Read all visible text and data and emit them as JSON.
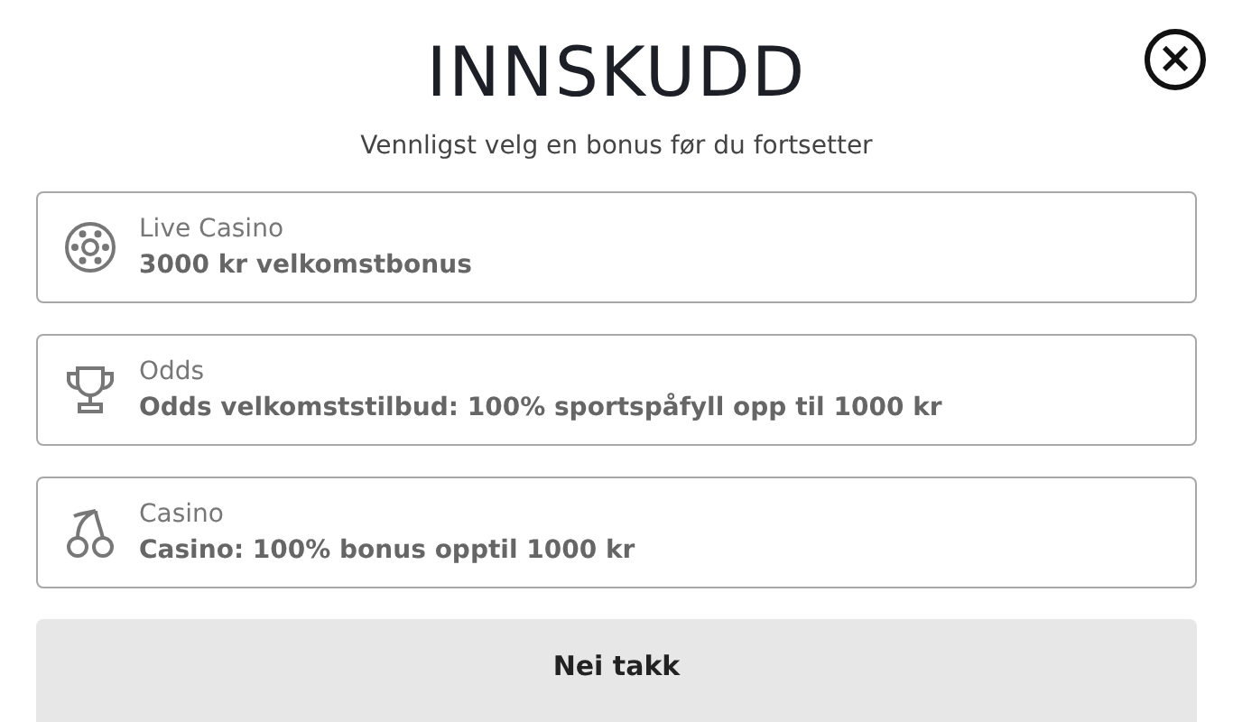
{
  "title": "INNSKUDD",
  "subtitle": "Vennligst velg en bonus før du fortsetter",
  "close": {
    "label": "×"
  },
  "bonuses": [
    {
      "kind": "wheel",
      "category": "Live Casino",
      "offer": "3000 kr velkomstbonus"
    },
    {
      "kind": "trophy",
      "category": "Odds",
      "offer": "Odds velkomststilbud: 100% sportspåfyll opp til 1000 kr"
    },
    {
      "kind": "cherries",
      "category": "Casino",
      "offer": "Casino: 100% bonus opptil 1000 kr"
    }
  ],
  "decline_button": "Nei takk"
}
